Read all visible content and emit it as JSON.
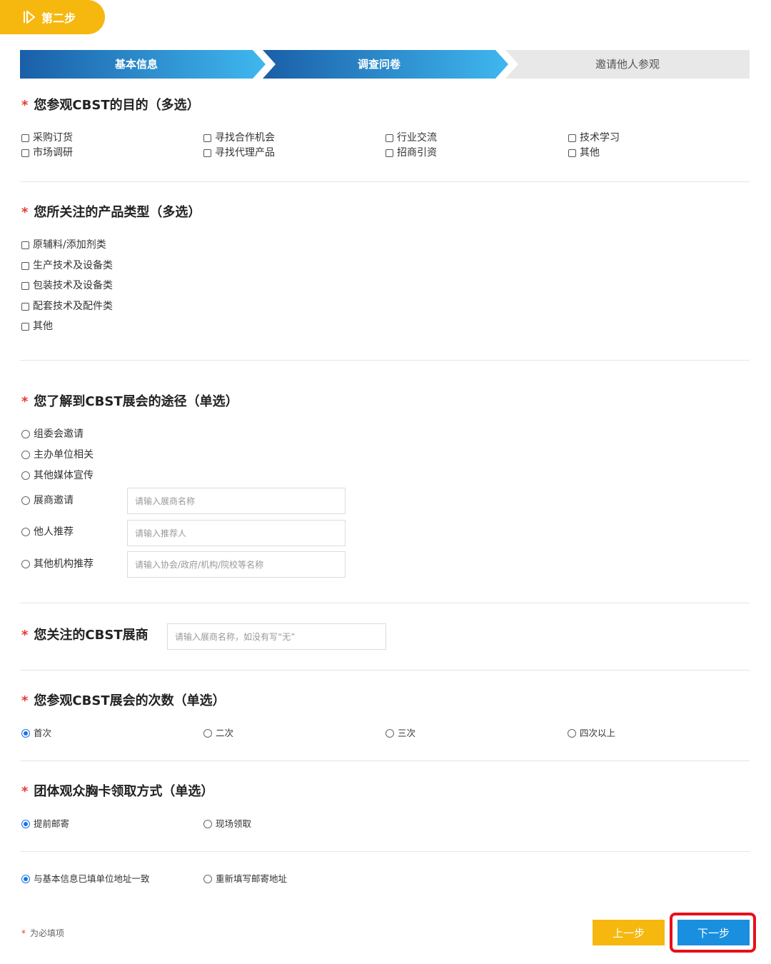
{
  "step_badge": {
    "label": "第二步"
  },
  "progress_steps": [
    {
      "label": "基本信息",
      "state": "done"
    },
    {
      "label": "调查问卷",
      "state": "active"
    },
    {
      "label": "邀请他人参观",
      "state": "inactive"
    }
  ],
  "q1": {
    "title": "您参观CBST的目的（多选）",
    "options": [
      "采购订货",
      "寻找合作机会",
      "行业交流",
      "技术学习",
      "市场调研",
      "寻找代理产品",
      "招商引资",
      "其他"
    ]
  },
  "q2": {
    "title": "您所关注的产品类型（多选）",
    "options": [
      "原辅料/添加剂类",
      "生产技术及设备类",
      "包装技术及设备类",
      "配套技术及配件类",
      "其他"
    ]
  },
  "q3": {
    "title": "您了解到CBST展会的途径（单选）",
    "options": [
      "组委会邀请",
      "主办单位相关",
      "其他媒体宣传",
      "展商邀请",
      "他人推荐",
      "其他机构推荐"
    ],
    "placeholders": {
      "exhibitor": "请输入展商名称",
      "referrer": "请输入推荐人",
      "institution": "请输入协会/政府/机构/院校等名称"
    }
  },
  "q4": {
    "title": "您关注的CBST展商",
    "placeholder": "请输入展商名称，如没有写“无”"
  },
  "q5": {
    "title": "您参观CBST展会的次数（单选）",
    "options": [
      "首次",
      "二次",
      "三次",
      "四次以上"
    ],
    "selected": "首次"
  },
  "q6": {
    "title": "团体观众胸卡领取方式（单选）",
    "options": [
      "提前邮寄",
      "现场领取"
    ],
    "selected": "提前邮寄",
    "address_options": [
      "与基本信息已填单位地址一致",
      "重新填写邮寄地址"
    ],
    "address_selected": "与基本信息已填单位地址一致"
  },
  "required_note": "为必填项",
  "required_mark": "*",
  "buttons": {
    "prev": "上一步",
    "next": "下一步"
  },
  "colors": {
    "accent_yellow": "#f6b80f",
    "step_blue_dark": "#1a5fa8",
    "step_blue_light": "#3fb7ef",
    "step_inactive": "#e8e8e8",
    "required_red": "#e53935",
    "highlight_red": "#e8101a",
    "radio_blue": "#1a73e8"
  }
}
